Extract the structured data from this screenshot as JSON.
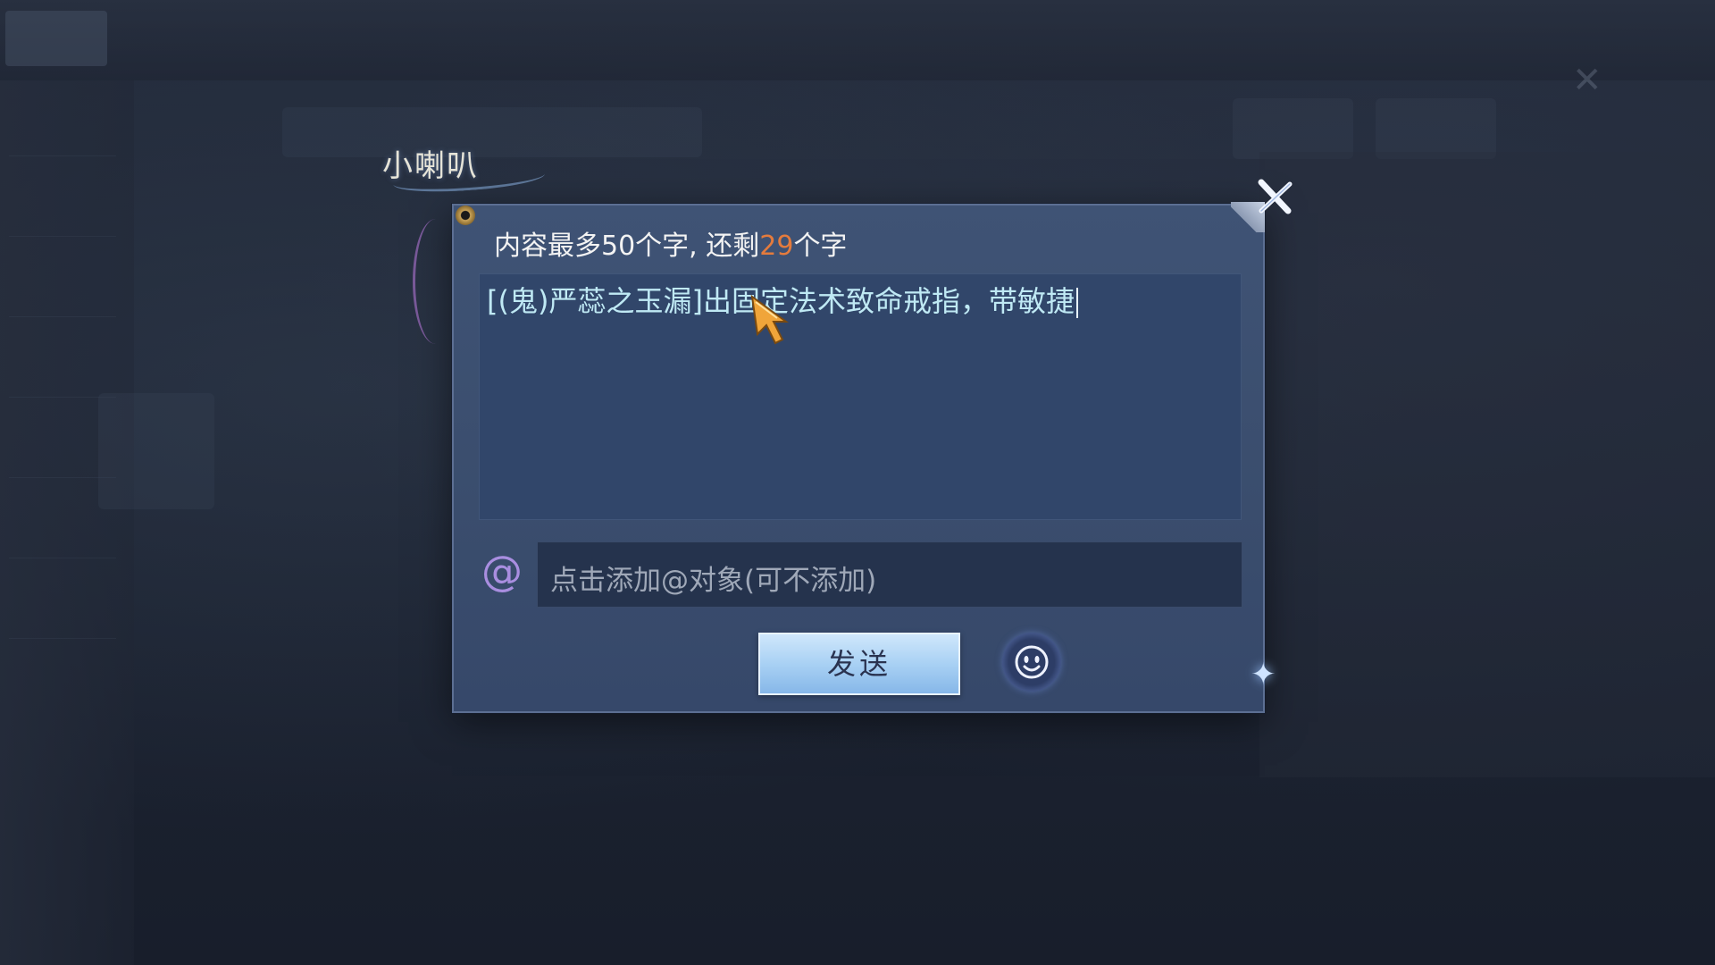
{
  "dialog": {
    "speaker_title": "小喇叭",
    "limit_prefix": "内容最多50个字, 还剩",
    "limit_remaining": "29",
    "limit_suffix": "个字",
    "message_text": "[(鬼)严蕊之玉漏]出固定法术致命戒指，带敏捷",
    "mention_placeholder": "点击添加@对象(可不添加)",
    "send_label": "发送",
    "at_symbol": "@"
  },
  "icons": {
    "close": "close-icon",
    "emoji": "smiley-face-icon",
    "cursor": "golden-arrow-cursor-icon"
  },
  "colors": {
    "remaining_count": "#e47b3d",
    "message_text": "#bfe9f4",
    "at_symbol": "#a98ee0",
    "send_button": "#a9d1f4"
  }
}
